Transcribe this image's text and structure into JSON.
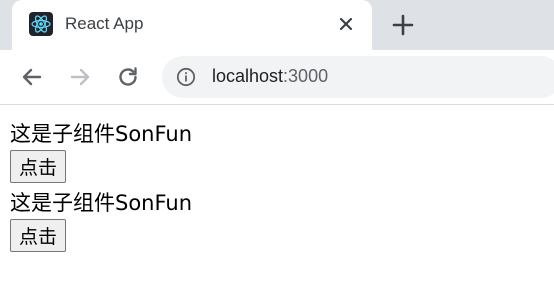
{
  "browser": {
    "tab_title": "React App",
    "url_host": "localhost",
    "url_port": ":3000",
    "favicon_icon": "react-logo-icon"
  },
  "page": {
    "items": [
      {
        "label": "这是子组件SonFun",
        "button_label": "点击"
      },
      {
        "label": "这是子组件SonFun",
        "button_label": "点击"
      }
    ]
  }
}
